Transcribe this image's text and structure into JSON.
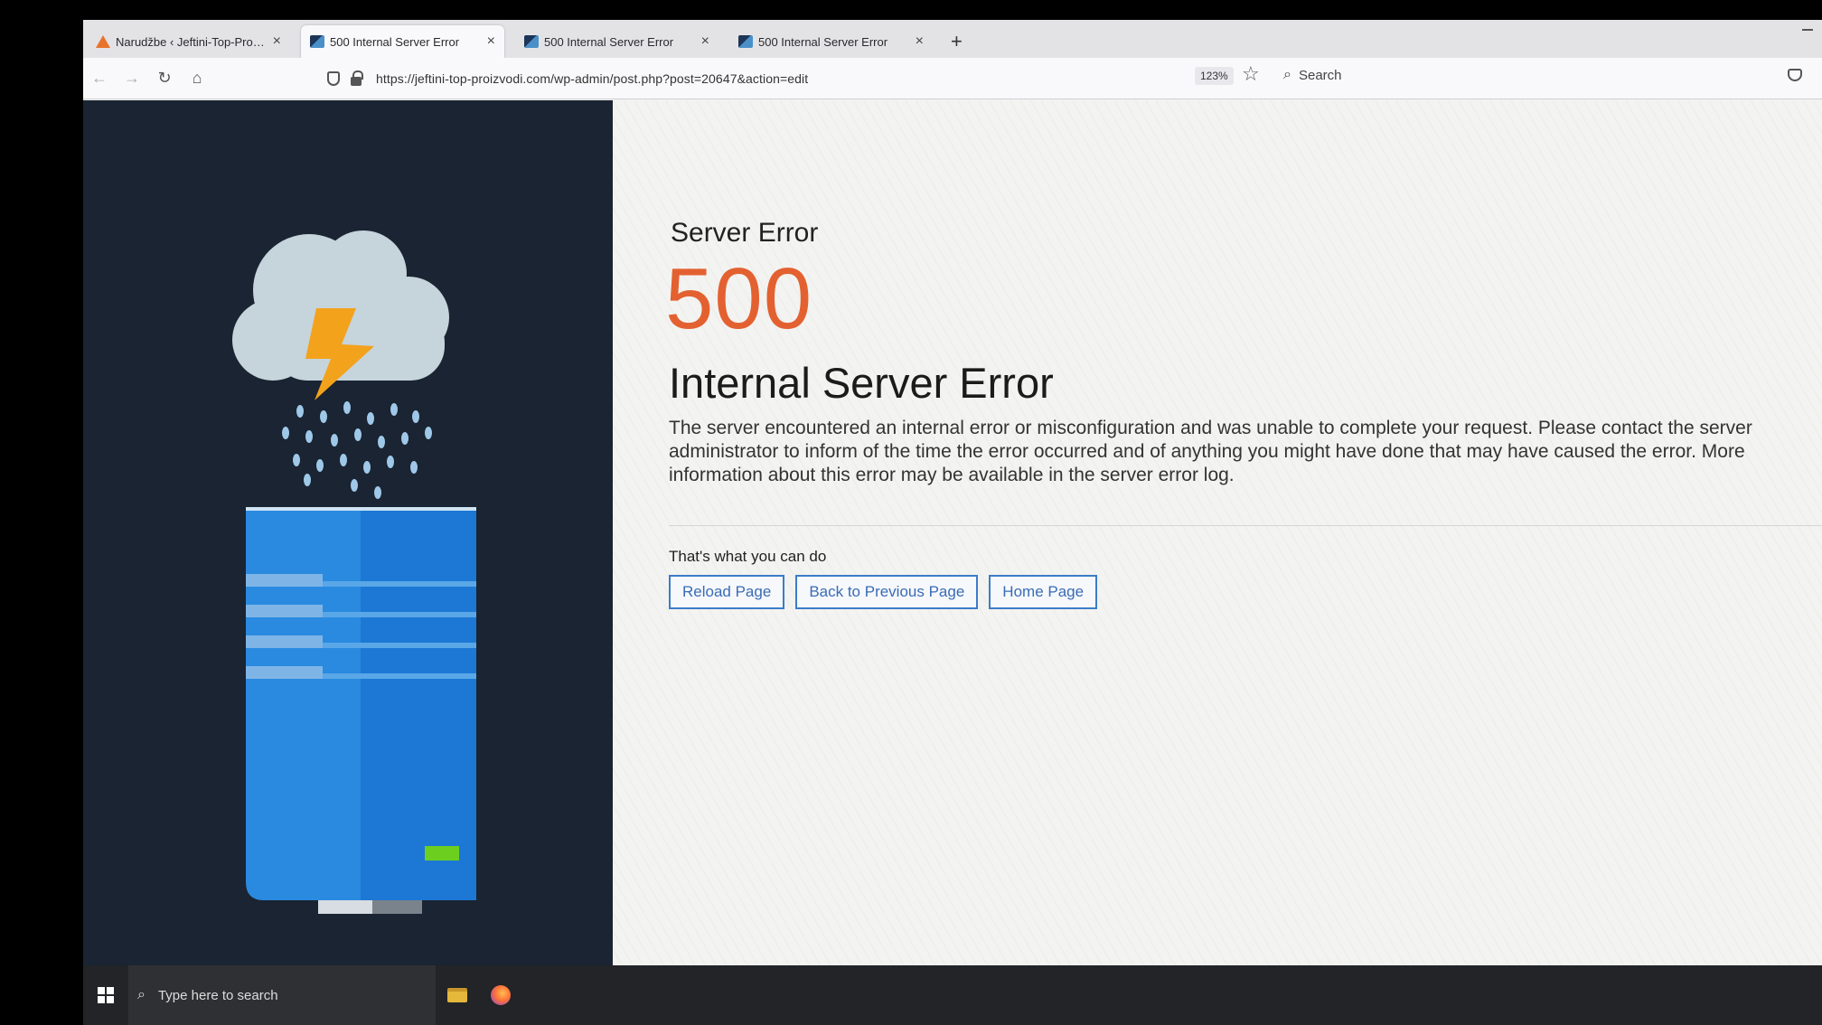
{
  "browser": {
    "tabs": [
      {
        "title": "Narudžbe ‹ Jeftini-Top-Proizvodi",
        "favicon": "wordpress-icon",
        "active": false
      },
      {
        "title": "500 Internal Server Error",
        "favicon": "server-error-icon",
        "active": true
      },
      {
        "title": "500 Internal Server Error",
        "favicon": "server-error-icon",
        "active": false
      },
      {
        "title": "500 Internal Server Error",
        "favicon": "server-error-icon",
        "active": false
      }
    ],
    "new_tab_label": "+",
    "url": "https://jeftini-top-proizvodi.com/wp-admin/post.php?post=20647&action=edit",
    "zoom": "123%",
    "search_placeholder": "Search"
  },
  "error_page": {
    "subtitle": "Server Error",
    "code": "500",
    "title": "Internal Server Error",
    "description": "The server encountered an internal error or misconfiguration and was unable to complete your request. Please contact the server administrator to inform of the time the error occurred and of anything you might have done that may have caused the error. More information about this error may be available in the server error log.",
    "actions_heading": "That's what you can do",
    "actions": {
      "reload": "Reload Page",
      "back": "Back to Previous Page",
      "home": "Home Page"
    }
  },
  "taskbar": {
    "search_placeholder": "Type here to search"
  },
  "colors": {
    "error_code": "#e36130",
    "left_panel": "#1a2432",
    "button_border": "#3b7dc9"
  }
}
